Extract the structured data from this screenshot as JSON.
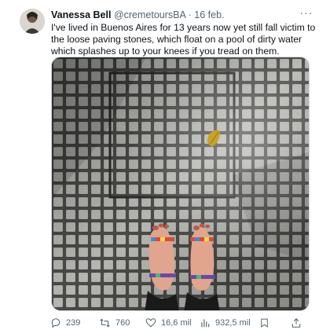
{
  "tweet": {
    "author_name": "Vanessa Bell",
    "author_handle": "@cremetoursBA",
    "separator": "·",
    "date": "16 feb.",
    "more_label": "···",
    "text": "I've lived in Buenos Aires for 13 years now yet still fall victim to the loose paving stones, which float on a pool of dirty water which splashes up to your knees if you tread on them."
  },
  "actions": {
    "replies": "239",
    "reposts": "760",
    "likes": "16,6 mil",
    "views": "932,5 mil"
  },
  "media": {
    "description_icon": "photo",
    "accent_leaf": "#c9a227",
    "tile_color": "#b9b9b6",
    "grout_color": "#4a4a48"
  },
  "colors": {
    "text": "#0f1419",
    "secondary": "#536471",
    "border": "#cfd9de"
  }
}
